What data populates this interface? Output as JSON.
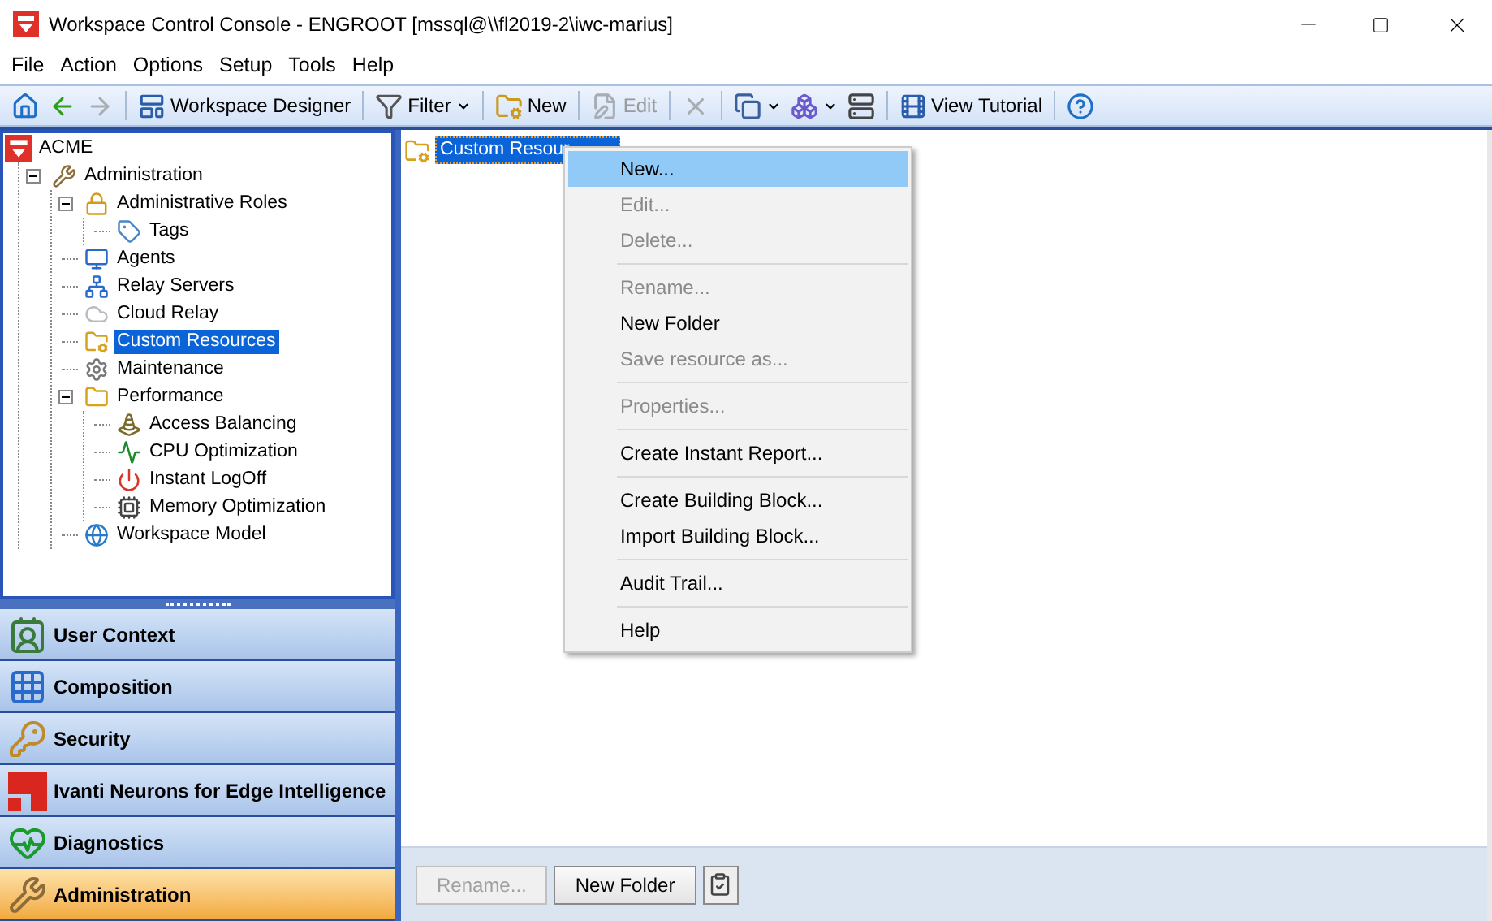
{
  "window": {
    "title": "Workspace Control Console - ENGROOT [mssql@\\\\fl2019-2\\iwc-marius]"
  },
  "menu": [
    "File",
    "Action",
    "Options",
    "Setup",
    "Tools",
    "Help"
  ],
  "toolbar": [
    {
      "disabled": false
    },
    {
      "disabled": false
    },
    {
      "disabled": true
    },
    {
      "label": "Workspace Designer",
      "disabled": false
    },
    {
      "label": "Filter",
      "disabled": false,
      "dropdown": true
    },
    {
      "label": "New",
      "disabled": false
    },
    {
      "label": "Edit",
      "disabled": true
    },
    {
      "disabled": true
    },
    {
      "disabled": false,
      "dropdown": true
    },
    {
      "disabled": false,
      "dropdown": true
    },
    {
      "disabled": false
    },
    {
      "label": "View Tutorial",
      "disabled": false
    },
    {
      "disabled": false
    }
  ],
  "tree": {
    "label": "ACME",
    "children": [
      {
        "label": "Administration",
        "expanded": true,
        "selected": false,
        "children": [
          {
            "label": "Administrative Roles",
            "expanded": true,
            "selected": false,
            "children": [
              {
                "label": "Tags",
                "selected": false
              }
            ]
          },
          {
            "label": "Agents",
            "selected": false
          },
          {
            "label": "Relay Servers",
            "selected": false
          },
          {
            "label": "Cloud Relay",
            "selected": false
          },
          {
            "label": "Custom Resources",
            "selected": true
          },
          {
            "label": "Maintenance",
            "selected": false
          },
          {
            "label": "Performance",
            "expanded": true,
            "selected": false,
            "children": [
              {
                "label": "Access Balancing",
                "selected": false
              },
              {
                "label": "CPU Optimization",
                "selected": false
              },
              {
                "label": "Instant LogOff",
                "selected": false
              },
              {
                "label": "Memory Optimization",
                "selected": false
              }
            ]
          },
          {
            "label": "Workspace Model",
            "selected": false
          }
        ]
      }
    ]
  },
  "nav": [
    {
      "label": "User Context",
      "selected": false
    },
    {
      "label": "Composition",
      "selected": false
    },
    {
      "label": "Security",
      "selected": false
    },
    {
      "label": "Ivanti Neurons for Edge Intelligence",
      "selected": false
    },
    {
      "label": "Diagnostics",
      "selected": false
    },
    {
      "label": "Administration",
      "selected": true
    }
  ],
  "content": {
    "items": [
      {
        "label": "Custom Resour",
        "selected": true
      }
    ]
  },
  "context_menu": [
    {
      "kind": "item",
      "label": "New...",
      "disabled": false,
      "selected": true
    },
    {
      "kind": "item",
      "label": "Edit...",
      "disabled": true,
      "selected": false
    },
    {
      "kind": "item",
      "label": "Delete...",
      "disabled": true,
      "selected": false
    },
    {
      "kind": "separator"
    },
    {
      "kind": "item",
      "label": "Rename...",
      "disabled": true,
      "selected": false
    },
    {
      "kind": "item",
      "label": "New Folder",
      "disabled": false,
      "selected": false
    },
    {
      "kind": "item",
      "label": "Save resource as...",
      "disabled": true,
      "selected": false
    },
    {
      "kind": "separator"
    },
    {
      "kind": "item",
      "label": "Properties...",
      "disabled": true,
      "selected": false
    },
    {
      "kind": "separator"
    },
    {
      "kind": "item",
      "label": "Create Instant Report...",
      "disabled": false,
      "selected": false
    },
    {
      "kind": "separator"
    },
    {
      "kind": "item",
      "label": "Create Building Block...",
      "disabled": false,
      "selected": false
    },
    {
      "kind": "item",
      "label": "Import Building Block...",
      "disabled": false,
      "selected": false
    },
    {
      "kind": "separator"
    },
    {
      "kind": "item",
      "label": "Audit Trail...",
      "disabled": false,
      "selected": false
    },
    {
      "kind": "separator"
    },
    {
      "kind": "item",
      "label": "Help",
      "disabled": false,
      "selected": false
    }
  ],
  "bottom_buttons": [
    {
      "label": "Rename...",
      "disabled": true
    },
    {
      "label": "New Folder",
      "disabled": false
    }
  ]
}
